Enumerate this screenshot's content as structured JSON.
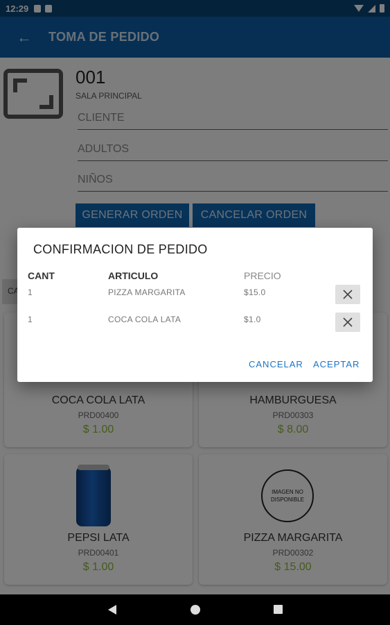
{
  "status_bar": {
    "time": "12:29"
  },
  "app_bar": {
    "title": "TOMA DE PEDIDO"
  },
  "table": {
    "number": "001",
    "zone": "SALA PRINCIPAL"
  },
  "form": {
    "cliente_placeholder": "CLIENTE",
    "adultos_placeholder": "ADULTOS",
    "ninos_placeholder": "NIÑOS",
    "generar_label": "GENERAR ORDEN",
    "cancelar_label": "CANCELAR ORDEN"
  },
  "category_tab": "CA",
  "products": [
    {
      "name": "COCA COLA LATA",
      "code": "PRD00400",
      "price": "$ 1.00"
    },
    {
      "name": "HAMBURGUESA",
      "code": "PRD00303",
      "price": "$ 8.00"
    },
    {
      "name": "PEPSI LATA",
      "code": "PRD00401",
      "price": "$ 1.00"
    },
    {
      "name": "PIZZA MARGARITA",
      "code": "PRD00302",
      "price": "$ 15.00",
      "image_text": "IMAGEN NO DISPONIBLE"
    }
  ],
  "dialog": {
    "title": "CONFIRMACION DE PEDIDO",
    "headers": {
      "qty": "CANT",
      "item": "ARTICULO",
      "price": "PRECIO"
    },
    "rows": [
      {
        "qty": "1",
        "item": "PIZZA MARGARITA",
        "price": "$15.0"
      },
      {
        "qty": "1",
        "item": "COCA COLA LATA",
        "price": "$1.0"
      }
    ],
    "cancel_label": "CANCELAR",
    "accept_label": "ACEPTAR"
  },
  "icons": {
    "back": "arrow-left-icon",
    "delete": "close-icon",
    "table": "table-frame-icon"
  },
  "colors": {
    "primary": "#0d5fa6",
    "price_green": "#8ab63c",
    "accent": "#1a74c4"
  }
}
